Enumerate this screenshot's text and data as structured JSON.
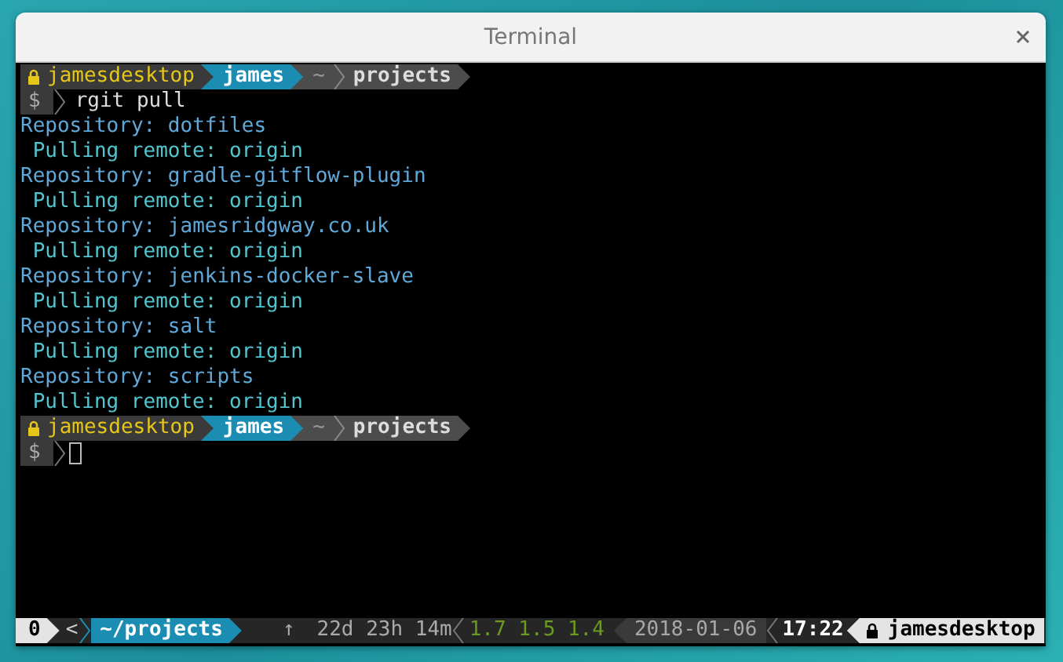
{
  "window": {
    "title": "Terminal"
  },
  "lines": [
    {
      "kind": "prompt",
      "host": "jamesdesktop",
      "user": "james",
      "path": [
        "~",
        "projects"
      ]
    },
    {
      "kind": "command",
      "symbol": "$",
      "text": "rgit pull"
    },
    {
      "kind": "repository",
      "text": "Repository: dotfiles"
    },
    {
      "kind": "pulling",
      "text": "Pulling remote: origin"
    },
    {
      "kind": "repository",
      "text": "Repository: gradle-gitflow-plugin"
    },
    {
      "kind": "pulling",
      "text": "Pulling remote: origin"
    },
    {
      "kind": "repository",
      "text": "Repository: jamesridgway.co.uk"
    },
    {
      "kind": "pulling",
      "text": "Pulling remote: origin"
    },
    {
      "kind": "repository",
      "text": "Repository: jenkins-docker-slave"
    },
    {
      "kind": "pulling",
      "text": "Pulling remote: origin"
    },
    {
      "kind": "repository",
      "text": "Repository: salt"
    },
    {
      "kind": "pulling",
      "text": "Pulling remote: origin"
    },
    {
      "kind": "repository",
      "text": "Repository: scripts"
    },
    {
      "kind": "pulling",
      "text": "Pulling remote: origin"
    },
    {
      "kind": "prompt",
      "host": "jamesdesktop",
      "user": "james",
      "path": [
        "~",
        "projects"
      ]
    },
    {
      "kind": "input",
      "symbol": "$"
    }
  ],
  "status_bar": {
    "window_index": "0",
    "left_marker": "<",
    "path": "~/projects",
    "uptime_arrow": "↑",
    "uptime": "22d 23h 14m",
    "load": "1.7 1.5 1.4",
    "date": "2018-01-06",
    "time": "17:22",
    "host": "jamesdesktop"
  }
}
